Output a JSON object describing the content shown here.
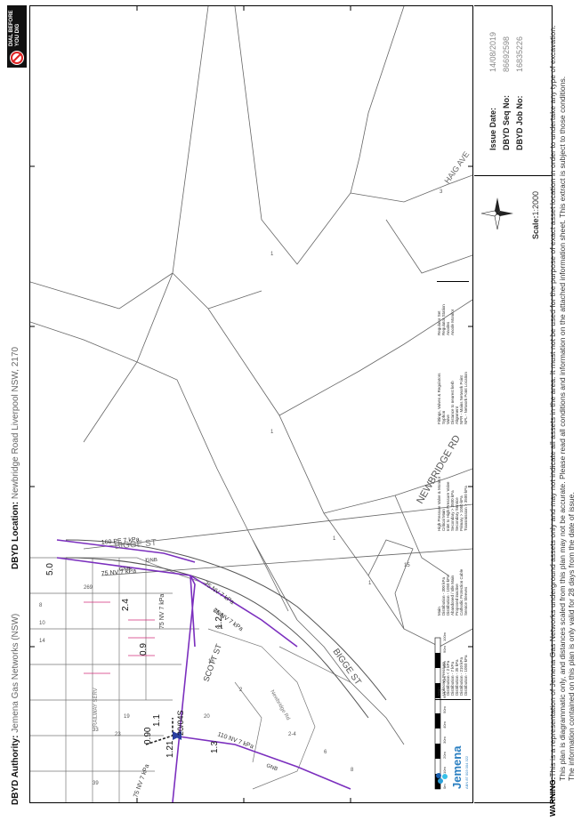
{
  "header": {
    "authority_label": "DBYD Authority:",
    "authority_value": "Jemena Gas Networks (NSW)",
    "location_label": "DBYD Location:",
    "location_value": "Newbridge Road Liverpool NSW, 2170"
  },
  "badge": {
    "line1": "DIAL BEFORE",
    "line2": "YOU DIG"
  },
  "issue": {
    "date_label": "Issue Date:",
    "date_value": "14/08/2019",
    "seq_label": "DBYD Seq No:",
    "seq_value": "86692598",
    "job_label": "DBYD Job No:",
    "job_value": "16835226",
    "scale_label": "Scale:",
    "scale_value": "1:2000"
  },
  "brand": {
    "name": "Jemena",
    "abn": "ABN 87 003 004 322",
    "color": "#2a7fc1"
  },
  "warning": {
    "label": "WARNING:",
    "line1": "This is a representation of Jemena Gas Networks underground assets only and may not indicate all assets in the area.  It must not be used for the purpose of exact asset location in order to undertake any type of excavation.",
    "line2": "This plan is diagrammatic only, and distances scaled from this plan may not be accurate. Please read all conditions and information on the attached information sheet.  This extract is subject to those conditions.",
    "line3": "The information contained on this plan is only valid for 28 days from the date of issue."
  },
  "map": {
    "streets": [
      "HAIG AVE",
      "NEWBRIDGE RD",
      "BIGGE ST",
      "BIGGE ST",
      "SCOTT ST",
      "Newbridge Rd",
      "RAILWAY SERV"
    ],
    "lot_numbers": [
      "3",
      "1",
      "1",
      "1",
      "15",
      "269",
      "14",
      "10",
      "8",
      "16",
      "20",
      "21",
      "2",
      "2-4",
      "19",
      "33",
      "23",
      "39",
      "6",
      "8",
      "1"
    ],
    "pipe_labels": [
      "160 PE 7 kPa",
      "75 NV 7 kPa",
      "75 NV 7 kPa",
      "75 NV 7 kPa",
      "75 NV 7 kPa",
      "110 NV 7 kPa",
      "75 NV 7 kPa"
    ],
    "depth_labels": [
      "5.0",
      "2.4",
      "0.9",
      "1.2",
      "1.1",
      "0.90",
      "1.3",
      "1.21"
    ],
    "bend_labels": [
      "GNB",
      "GNB",
      "GNB",
      "GNB"
    ],
    "point_label": "20/04S",
    "gas_color": "#7b2fbe"
  },
  "legend": {
    "groups": [
      {
        "title": "Main",
        "items": [
          "Unknown Pressure",
          "Distribution < 2 kPa",
          "Distribution - 7 kPa",
          "Distribution - 35 kPa",
          "Distribution - 210 kPa",
          "Distribution - 1050 kPa"
        ],
        "headers": [
          "In Service",
          "Proposed"
        ]
      },
      {
        "title": "Main",
        "items": [
          "Distribution - 300 kPa",
          "Distribution - 1050 kPa",
          "Abandoned / Idle Main",
          "Proposed inactive",
          "Cathodic Protection Cable",
          "Service Sleeves"
        ],
        "headers": [
          "In Service",
          "Proposed"
        ]
      },
      {
        "title": "High Pressure Valve & Monitor",
        "items": [
          "Critical Main",
          "Inlet to High Pressure Valve",
          "Secondary > 3500 kPa",
          "Secondary Service",
          "Primary > 1050 kPa",
          "Transmission > 3500 kPa"
        ],
        "headers": [
          "In Service",
          "Proposed"
        ]
      },
      {
        "title": "Fittings, Valves & Regulators",
        "items": [
          "Syphon",
          "Valve",
          "Distance to nearest kerb",
          "Alignment",
          "NPR - Mains Network Point",
          "NPL - Network Point Location"
        ]
      },
      {
        "title": "",
        "items": [
          "Regulator Set",
          "Regulator Station",
          "Anodes",
          "Anode Monitor"
        ]
      }
    ],
    "colors": {
      "unknown": "#555555",
      "lt2": "#e0a020",
      "kpa7": "#d7b01e",
      "kpa35": "#d12b7a",
      "kpa210": "#2ab0d8",
      "kpa1050": "#1a4fa0",
      "transmission": "#e0701e",
      "secondary": "#33cc33",
      "primary": "#e040e0",
      "critical": "#8a3fb0"
    }
  },
  "scale_bar": {
    "ticks": [
      "0m",
      "10m",
      "20m",
      "30m",
      "40m",
      "50m",
      "60m",
      "70m",
      "80m",
      "90m",
      "100m"
    ]
  }
}
